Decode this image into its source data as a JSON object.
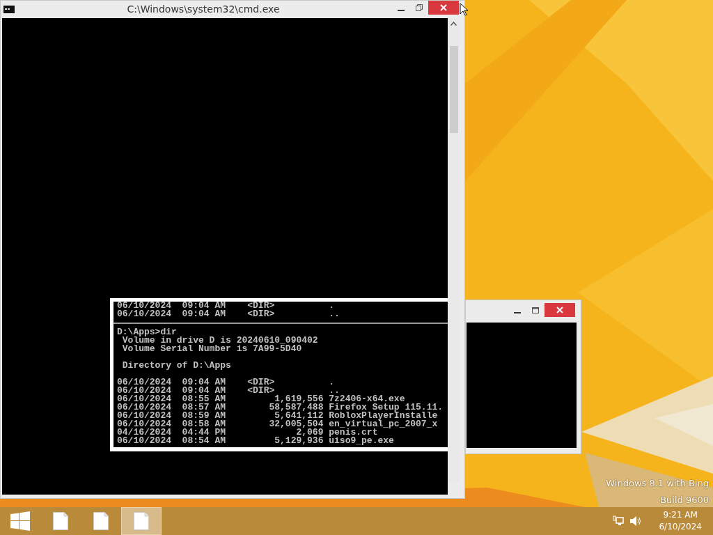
{
  "console_window": {
    "title": "C:\\Windows\\system32\\cmd.exe",
    "lines": [
      {
        "kind": "text",
        "text": "06/10/2024  09:04 AM    <DIR>          ."
      },
      {
        "kind": "text",
        "text": "06/10/2024  09:04 AM    <DIR>          .."
      },
      {
        "kind": "rule"
      },
      {
        "kind": "text",
        "text": "D:\\Apps>dir"
      },
      {
        "kind": "text",
        "text": " Volume in drive D is 20240610_090402"
      },
      {
        "kind": "text",
        "text": " Volume Serial Number is 7A99-5D40"
      },
      {
        "kind": "blank"
      },
      {
        "kind": "text",
        "text": " Directory of D:\\Apps"
      },
      {
        "kind": "blank"
      },
      {
        "kind": "text",
        "text": "06/10/2024  09:04 AM    <DIR>          ."
      },
      {
        "kind": "text",
        "text": "06/10/2024  09:04 AM    <DIR>          .."
      },
      {
        "kind": "text",
        "text": "06/10/2024  08:55 AM         1,619,556 7z2406-x64.exe"
      },
      {
        "kind": "text",
        "text": "06/10/2024  08:57 AM        58,587,488 Firefox Setup 115.11."
      },
      {
        "kind": "text",
        "text": "06/10/2024  08:59 AM         5,641,112 RobloxPlayerInstalle"
      },
      {
        "kind": "text",
        "text": "06/10/2024  08:58 AM        32,005,504 en_virtual_pc_2007_x"
      },
      {
        "kind": "text",
        "text": "04/16/2024  04:44 PM             2,069 penis.crt"
      },
      {
        "kind": "text",
        "text": "06/10/2024  08:54 AM         5,129,936 uiso9_pe.exe"
      }
    ]
  },
  "desktop": {
    "watermark": [
      "Windows 8.1 with Bing",
      "Build 9600"
    ]
  },
  "taskbar": {
    "buttons": [
      {
        "kind": "start",
        "selected": false
      },
      {
        "kind": "file",
        "selected": false
      },
      {
        "kind": "file",
        "selected": false
      },
      {
        "kind": "file",
        "selected": true
      }
    ],
    "clock": {
      "time": "9:21 AM",
      "date": "6/10/2024"
    }
  }
}
